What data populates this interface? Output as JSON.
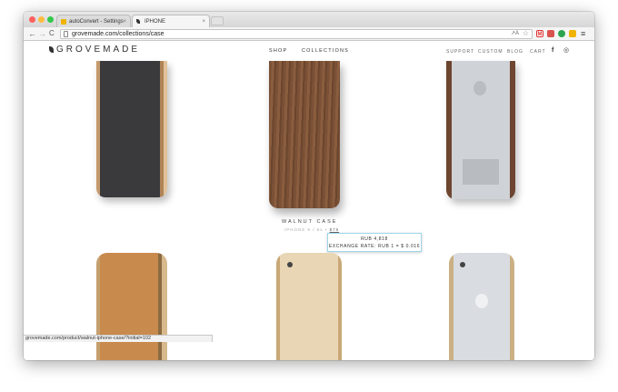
{
  "browser": {
    "tabs": [
      {
        "label": "autoConvert - Settings",
        "active": false
      },
      {
        "label": "IPHONE",
        "active": true
      }
    ],
    "tab_close": "×",
    "url": "grovemade.com/collections/case",
    "nav": {
      "back": "←",
      "forward": "→",
      "reload": "C"
    },
    "status_url": "grovemade.com/product/walnut-iphone-case/?initial=102",
    "colors": {
      "close": "#fc605c",
      "minimize": "#fdbc40",
      "maximize": "#34c84a"
    }
  },
  "site": {
    "logo": "GROVEMADE",
    "nav_center": [
      "SHOP",
      "COLLECTIONS"
    ],
    "nav_right": [
      "SUPPORT",
      "CUSTOM",
      "BLOG",
      "CART"
    ],
    "social": [
      "f",
      "◎"
    ]
  },
  "product": {
    "name": "WALNUT CASE",
    "subtitle": "IPHONE 5 / 5s •",
    "price": "$79"
  },
  "tooltip": {
    "line1": "RUB 4,818",
    "line2": "EXCHANGE RATE: RUB 1 = $ 0.016"
  }
}
